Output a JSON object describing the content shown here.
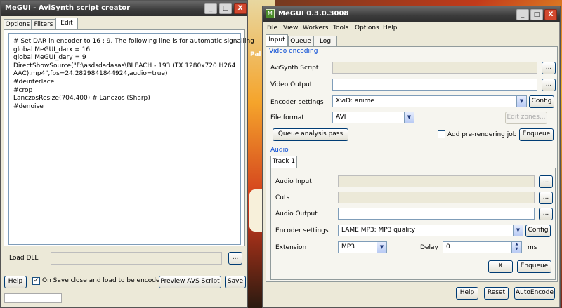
{
  "avs_window": {
    "title": "MeGUI - AviSynth script creator",
    "title_buttons": {
      "minimize": "_",
      "maximize": "□",
      "close": "X"
    },
    "tabs": [
      "Options",
      "Filters",
      "Edit"
    ],
    "active_tab": "Edit",
    "script_lines": [
      "# Set DAR in encoder to 16 : 9. The following line is for automatic signalling",
      "global MeGUI_darx = 16",
      "global MeGUI_dary = 9",
      "DirectShowSource(\"F:\\asdsdadasas\\BLEACH - 193 (TX 1280x720 H264",
      "AAC).mp4\",fps=24.2829841844924,audio=true)",
      "#deinterlace",
      "#crop",
      "LanczosResize(704,400) # Lanczos (Sharp)",
      "#denoise"
    ],
    "load_dll_label": "Load DLL",
    "load_dll_value": "",
    "browse_label": "...",
    "help_label": "Help",
    "on_save_label": "On Save close and load to be encoded",
    "on_save_checked": true,
    "preview_label": "Preview AVS Script",
    "save_label": "Save"
  },
  "megui": {
    "title": "MeGUI 0.3.0.3008",
    "title_buttons": {
      "minimize": "_",
      "maximize": "□",
      "close": "X"
    },
    "menu": [
      "File",
      "View",
      "Workers",
      "Tools",
      "Options",
      "Help"
    ],
    "tabs": [
      "Input",
      "Queue",
      "Log"
    ],
    "active_tab": "Input",
    "video": {
      "group_title": "Video encoding",
      "avisynth_label": "AviSynth Script",
      "avisynth_value": "",
      "output_label": "Video Output",
      "output_value": "",
      "encoder_label": "Encoder settings",
      "encoder_value": "XviD: anime",
      "config_label": "Config",
      "format_label": "File format",
      "format_value": "AVI",
      "edit_zones_label": "Edit zones...",
      "queue_analysis_label": "Queue analysis pass",
      "prerender_label": "Add pre-rendering job",
      "prerender_checked": false,
      "enqueue_label": "Enqueue"
    },
    "audio": {
      "group_title": "Audio",
      "track_tab": "Track 1",
      "input_label": "Audio Input",
      "input_value": "",
      "cuts_label": "Cuts",
      "cuts_value": "",
      "output_label": "Audio Output",
      "output_value": "",
      "encoder_label": "Encoder settings",
      "encoder_value": "LAME MP3: MP3 quality",
      "config_label": "Config",
      "extension_label": "Extension",
      "extension_value": "MP3",
      "delay_label": "Delay",
      "delay_value": "0",
      "delay_unit": "ms",
      "x_label": "X",
      "enqueue_label": "Enqueue"
    },
    "bottom": {
      "help": "Help",
      "reset": "Reset",
      "autoencode": "AutoEncode"
    },
    "browse_label": "..."
  },
  "desktop_fragment_text": "Pal"
}
